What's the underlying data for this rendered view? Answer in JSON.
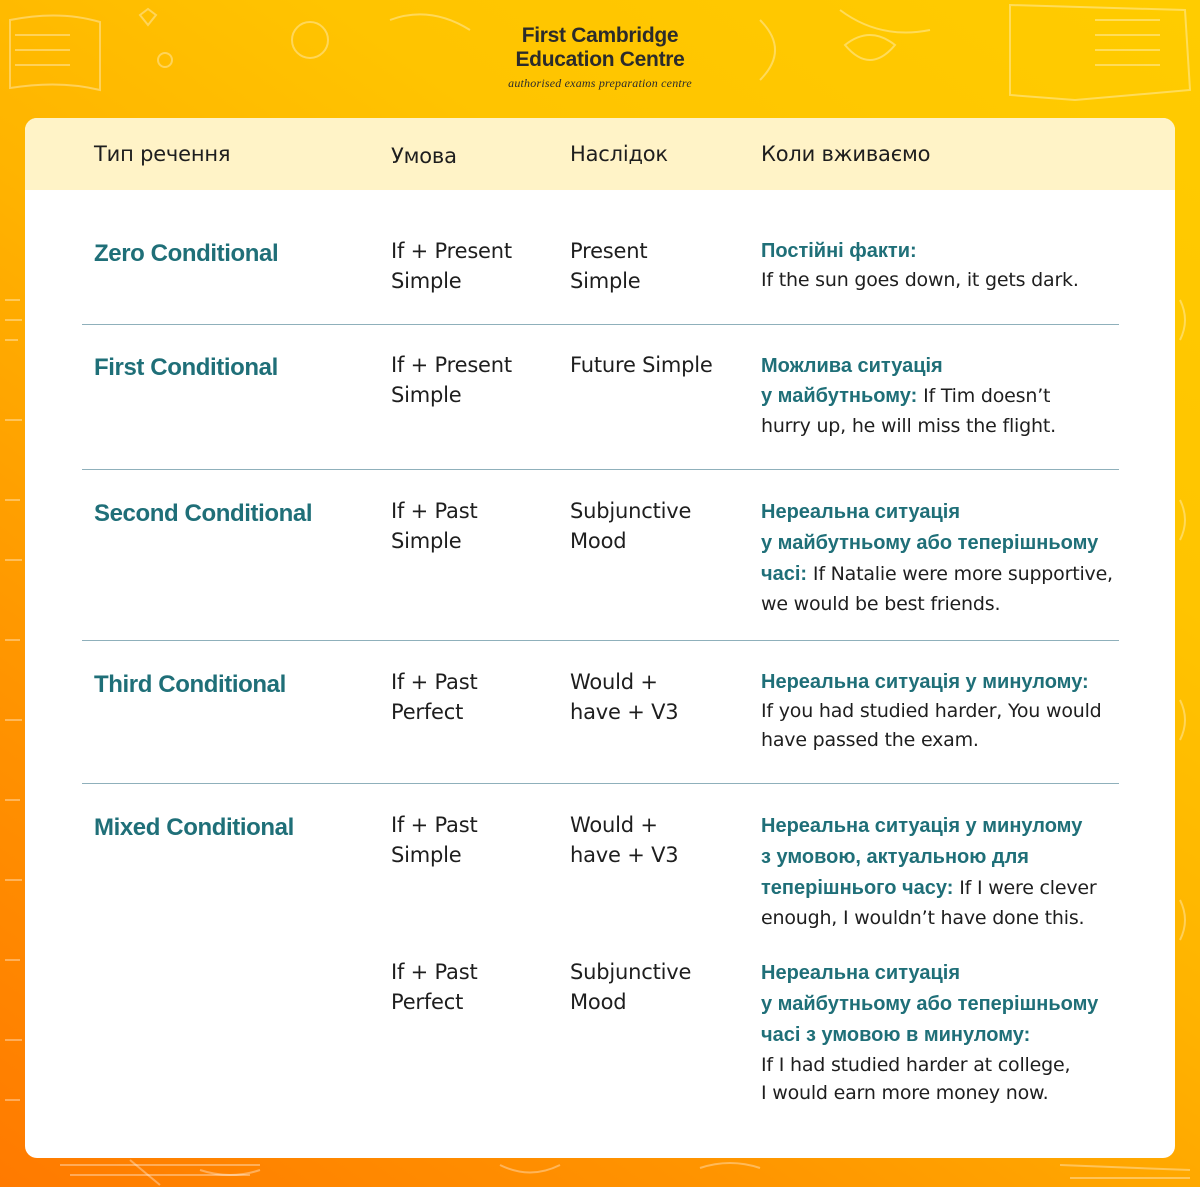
{
  "brand": {
    "name_line1": "First Cambridge",
    "name_line2": "Education Centre",
    "tagline": "authorised exams preparation centre"
  },
  "colors": {
    "accent_teal": "#1f6f78",
    "header_band": "#fff3c7",
    "bg_orange": "#ff7a00",
    "bg_yellow": "#ffcc00"
  },
  "table": {
    "headers": {
      "type": "Тип речення",
      "condition": "Умова",
      "result": "Наслідок",
      "usage": "Коли вживаємо"
    },
    "rows": [
      {
        "type": "Zero Conditional",
        "condition": [
          "If + Present",
          "Simple"
        ],
        "result": [
          "Present",
          "Simple"
        ],
        "usage_heading": [
          "Постійні факти:"
        ],
        "usage_example": [
          "If the sun goes down, it gets dark."
        ]
      },
      {
        "type": "First Conditional",
        "condition": [
          "If + Present",
          "Simple"
        ],
        "result": [
          "Future Simple"
        ],
        "usage_heading": [
          "Можлива ситуація",
          "у майбутньому:"
        ],
        "usage_example_inline": "If Tim doesn’t",
        "usage_example": [
          "hurry up, he will miss the flight."
        ]
      },
      {
        "type": "Second Conditional",
        "condition": [
          "If + Past",
          "Simple"
        ],
        "result": [
          "Subjunctive",
          "Mood"
        ],
        "usage_heading": [
          "Нереальна ситуація",
          "у майбутньому або теперішньому",
          "часі:"
        ],
        "usage_example_inline": "If Natalie were more supportive,",
        "usage_example": [
          "we would be best friends."
        ]
      },
      {
        "type": "Third Conditional",
        "condition": [
          "If + Past",
          "Perfect"
        ],
        "result": [
          "Would +",
          "have + V3"
        ],
        "usage_heading": [
          "Нереальна ситуація у минулому:"
        ],
        "usage_example": [
          "If you had studied harder, You would",
          "have passed the exam."
        ]
      },
      {
        "type": "Mixed Conditional",
        "condition": [
          "If + Past",
          "Simple"
        ],
        "result": [
          "Would +",
          "have + V3"
        ],
        "usage_heading": [
          "Нереальна ситуація у минулому",
          "з умовою, актуальною для",
          "теперішнього часу:"
        ],
        "usage_example_inline": "If I were clever",
        "usage_example": [
          "enough, I wouldn’t have done this."
        ]
      },
      {
        "type": "",
        "condition": [
          "If + Past",
          "Perfect"
        ],
        "result": [
          "Subjunctive",
          "Mood"
        ],
        "usage_heading": [
          "Нереальна ситуація",
          "у майбутньому або теперішньому",
          "часі з умовою в минулому:"
        ],
        "usage_example": [
          "If I had studied harder at college,",
          "I would earn more money now."
        ]
      }
    ]
  }
}
